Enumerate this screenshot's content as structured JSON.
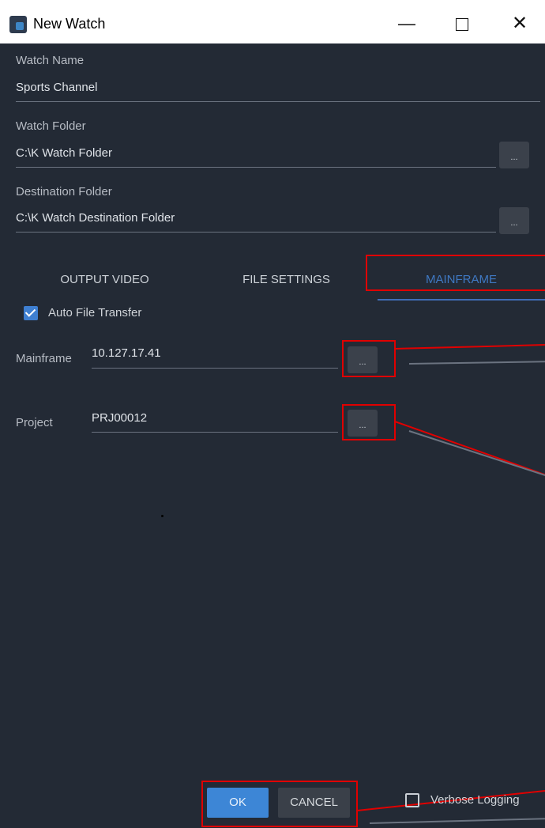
{
  "window": {
    "title": "New Watch"
  },
  "fields": {
    "watch_name": {
      "label": "Watch Name",
      "value": "Sports Channel"
    },
    "watch_folder": {
      "label": "Watch Folder",
      "value": "C:\\K Watch Folder",
      "browse": "..."
    },
    "destination_folder": {
      "label": "Destination Folder",
      "value": "C:\\K Watch Destination Folder",
      "browse": "..."
    }
  },
  "tabs": [
    "OUTPUT VIDEO",
    "FILE SETTINGS",
    "MAINFRAME"
  ],
  "active_tab": "MAINFRAME",
  "mainframe": {
    "auto_transfer": {
      "label": "Auto File Transfer",
      "checked": true
    },
    "mainframe": {
      "label": "Mainframe",
      "value": "10.127.17.41",
      "browse": "..."
    },
    "project": {
      "label": "Project",
      "value": "PRJ00012",
      "browse": "..."
    }
  },
  "footer": {
    "ok": "OK",
    "cancel": "CANCEL",
    "verbose": {
      "label": "Verbose Logging",
      "checked": false
    }
  },
  "colors": {
    "background": "#232a35",
    "accent": "#3d86d6",
    "annotation": "#e00000"
  }
}
